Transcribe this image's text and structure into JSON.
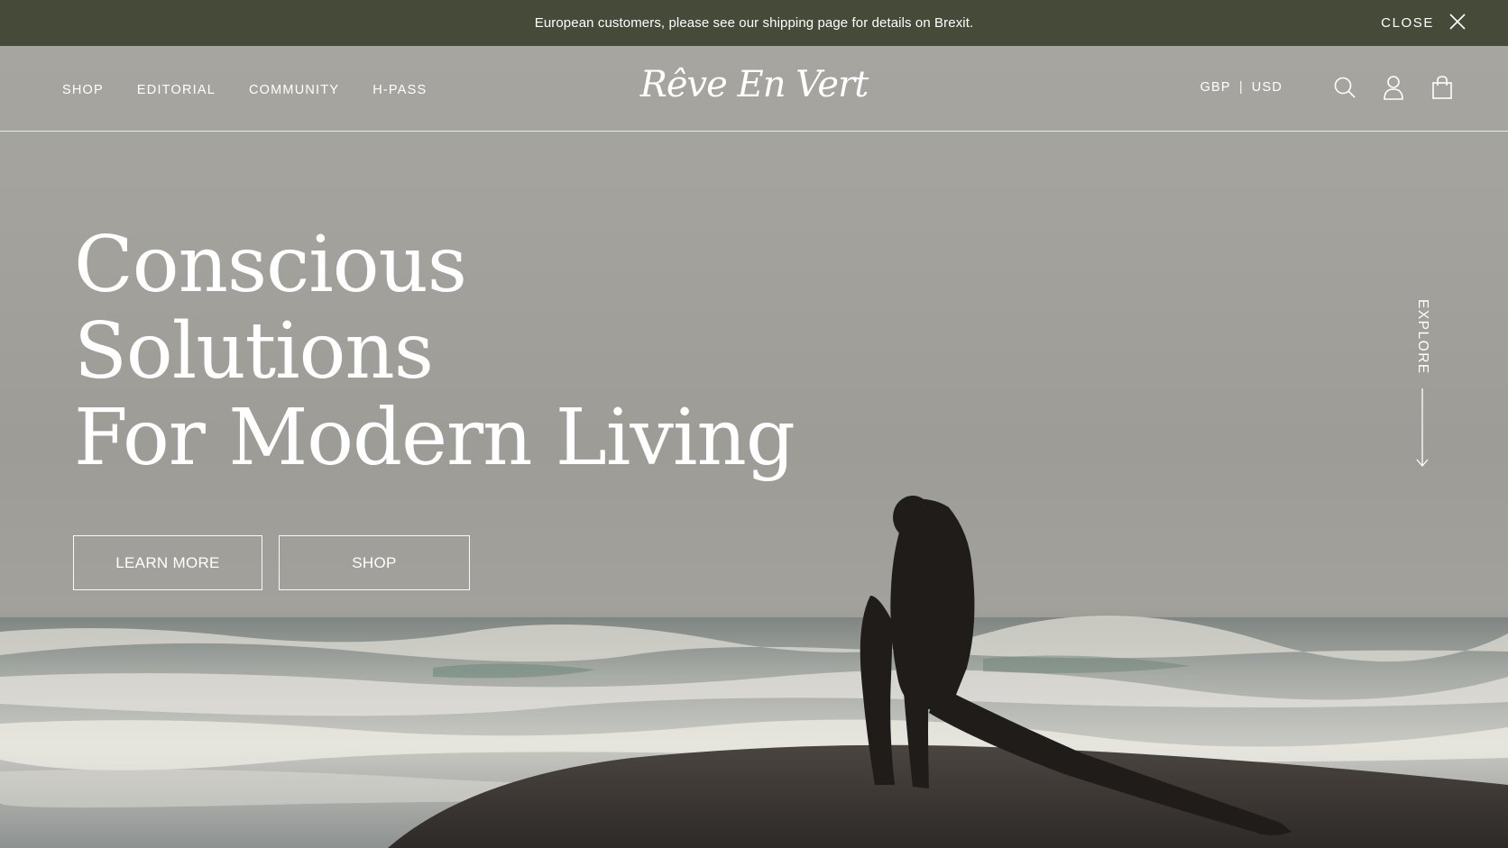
{
  "announcement": {
    "text": "European customers, please see our shipping page for details on Brexit.",
    "close_label": "CLOSE",
    "background": "#454a39"
  },
  "nav": {
    "links": [
      {
        "label": "SHOP"
      },
      {
        "label": "EDITORIAL"
      },
      {
        "label": "COMMUNITY"
      },
      {
        "label": "H-PASS"
      }
    ],
    "logo": "Rêve En Vert",
    "currency": {
      "gbp": "GBP",
      "separator": "|",
      "usd": "USD"
    },
    "icons": [
      "search-icon",
      "account-icon",
      "bag-icon"
    ]
  },
  "hero": {
    "headline": [
      "Conscious",
      "Solutions",
      "For Modern Living"
    ],
    "buttons": {
      "learn_more": "LEARN MORE",
      "shop": "SHOP"
    },
    "explore_label": "EXPLORE"
  }
}
